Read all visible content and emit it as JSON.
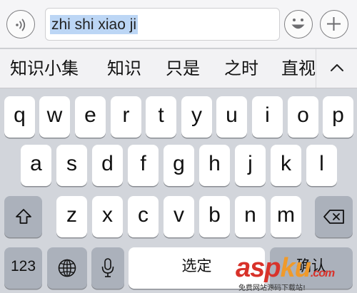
{
  "input": {
    "text": "zhi shi xiao ji"
  },
  "toolbar": {
    "voice_icon": "voice-wave-icon",
    "emoji_icon": "smiley-icon",
    "plus_icon": "plus-icon"
  },
  "candidates": {
    "items": [
      "知识小集",
      "知识",
      "只是",
      "之时",
      "直视"
    ],
    "expand_icon": "chevron-up-icon"
  },
  "keyboard": {
    "row1": [
      "q",
      "w",
      "e",
      "r",
      "t",
      "y",
      "u",
      "i",
      "o",
      "p"
    ],
    "row2": [
      "a",
      "s",
      "d",
      "f",
      "g",
      "h",
      "j",
      "k",
      "l"
    ],
    "row3": [
      "z",
      "x",
      "c",
      "v",
      "b",
      "n",
      "m"
    ],
    "numbers_label": "123",
    "space_label": "选定",
    "return_label": "确认",
    "shift_icon": "shift-arrow-icon",
    "delete_icon": "backspace-icon",
    "globe_icon": "globe-icon",
    "mic_icon": "microphone-icon"
  },
  "watermark": {
    "logo_main": "asp",
    "logo_accent": "ku",
    "logo_suffix": ".com",
    "subtitle": "免费网站源码下载站!"
  },
  "colors": {
    "key_background": "#ffffff",
    "function_key_background": "#abb1bb",
    "keyboard_background": "#d2d5db",
    "selection_highlight": "#bcd6f5",
    "watermark_red": "#d8322a",
    "watermark_orange": "#f09a2a"
  }
}
